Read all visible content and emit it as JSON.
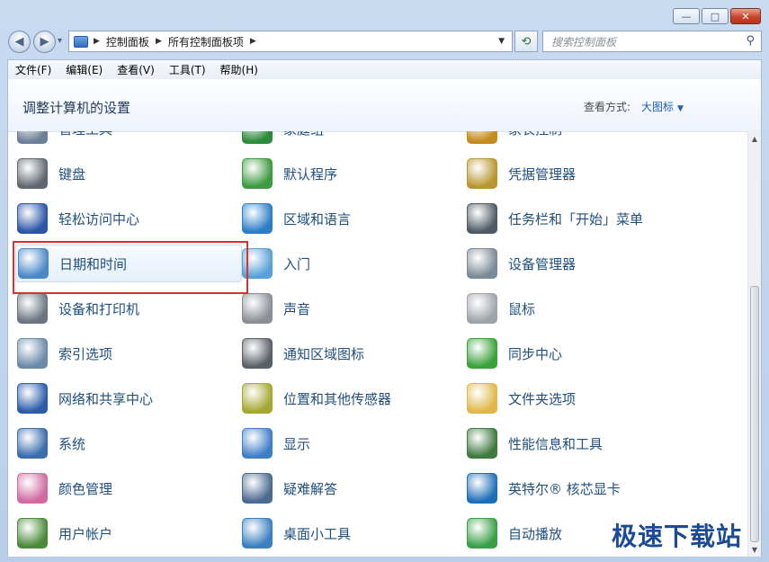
{
  "window": {
    "caption_buttons": [
      {
        "name": "minimize-button",
        "symbol": "—"
      },
      {
        "name": "maximize-button",
        "symbol": "□"
      },
      {
        "name": "close-button",
        "symbol": "✕"
      }
    ]
  },
  "nav": {
    "back_symbol": "◀",
    "forward_symbol": "▶",
    "recent_symbol": "▾",
    "breadcrumb": [
      "控制面板",
      "所有控制面板项"
    ],
    "crumb_sep": "▶",
    "refresh_symbol": "⟲",
    "search_placeholder": "搜索控制面板",
    "search_symbol": "⚲"
  },
  "menubar": {
    "items": [
      "文件(F)",
      "编辑(E)",
      "查看(V)",
      "工具(T)",
      "帮助(H)"
    ]
  },
  "header": {
    "title": "调整计算机的设置",
    "view_by_label": "查看方式:",
    "view_by_value": "大图标",
    "view_by_arrow": "▼"
  },
  "items": [
    {
      "label": "管理工具",
      "icon": "admin-tools-icon",
      "color": "#6c7f96"
    },
    {
      "label": "家庭组",
      "icon": "homegroup-icon",
      "color": "#2e8b3c"
    },
    {
      "label": "家长控制",
      "icon": "parental-controls-icon",
      "color": "#c58b1d"
    },
    {
      "label": "键盘",
      "icon": "keyboard-icon",
      "color": "#5f6870"
    },
    {
      "label": "默认程序",
      "icon": "default-programs-icon",
      "color": "#3c9a3f"
    },
    {
      "label": "凭据管理器",
      "icon": "credential-manager-icon",
      "color": "#b8962f"
    },
    {
      "label": "轻松访问中心",
      "icon": "ease-of-access-icon",
      "color": "#2a55a8"
    },
    {
      "label": "区域和语言",
      "icon": "region-language-icon",
      "color": "#2a7ec8"
    },
    {
      "label": "任务栏和「开始」菜单",
      "icon": "taskbar-start-icon",
      "color": "#4f5a64"
    },
    {
      "label": "日期和时间",
      "icon": "date-time-icon",
      "color": "#4a88c8",
      "selected": true
    },
    {
      "label": "入门",
      "icon": "getting-started-icon",
      "color": "#5aa0d8"
    },
    {
      "label": "设备管理器",
      "icon": "device-manager-icon",
      "color": "#7a8a96"
    },
    {
      "label": "设备和打印机",
      "icon": "devices-printers-icon",
      "color": "#6a7580"
    },
    {
      "label": "声音",
      "icon": "sound-icon",
      "color": "#8a8f96"
    },
    {
      "label": "鼠标",
      "icon": "mouse-icon",
      "color": "#9ea4aa"
    },
    {
      "label": "索引选项",
      "icon": "indexing-options-icon",
      "color": "#6b8aa8"
    },
    {
      "label": "通知区域图标",
      "icon": "notification-area-icon",
      "color": "#5a6068"
    },
    {
      "label": "同步中心",
      "icon": "sync-center-icon",
      "color": "#3aa23a"
    },
    {
      "label": "网络和共享中心",
      "icon": "network-sharing-icon",
      "color": "#2a5caa"
    },
    {
      "label": "位置和其他传感器",
      "icon": "location-sensors-icon",
      "color": "#a4a830"
    },
    {
      "label": "文件夹选项",
      "icon": "folder-options-icon",
      "color": "#e0b84a"
    },
    {
      "label": "系统",
      "icon": "system-icon",
      "color": "#3a6cb0"
    },
    {
      "label": "显示",
      "icon": "display-icon",
      "color": "#3e7dc8"
    },
    {
      "label": "性能信息和工具",
      "icon": "performance-tools-icon",
      "color": "#3f7a3f"
    },
    {
      "label": "颜色管理",
      "icon": "color-management-icon",
      "color": "#d06aa0"
    },
    {
      "label": "疑难解答",
      "icon": "troubleshooting-icon",
      "color": "#4a6a90"
    },
    {
      "label": "英特尔® 核芯显卡",
      "icon": "intel-graphics-icon",
      "color": "#1e6fb8"
    },
    {
      "label": "用户帐户",
      "icon": "user-accounts-icon",
      "color": "#4a8a3a"
    },
    {
      "label": "桌面小工具",
      "icon": "desktop-gadgets-icon",
      "color": "#3a80c0"
    },
    {
      "label": "自动播放",
      "icon": "autoplay-icon",
      "color": "#3aa048"
    }
  ],
  "scrollbar": {
    "up_symbol": "▲",
    "down_symbol": "▼"
  },
  "watermark": "极速下载站"
}
